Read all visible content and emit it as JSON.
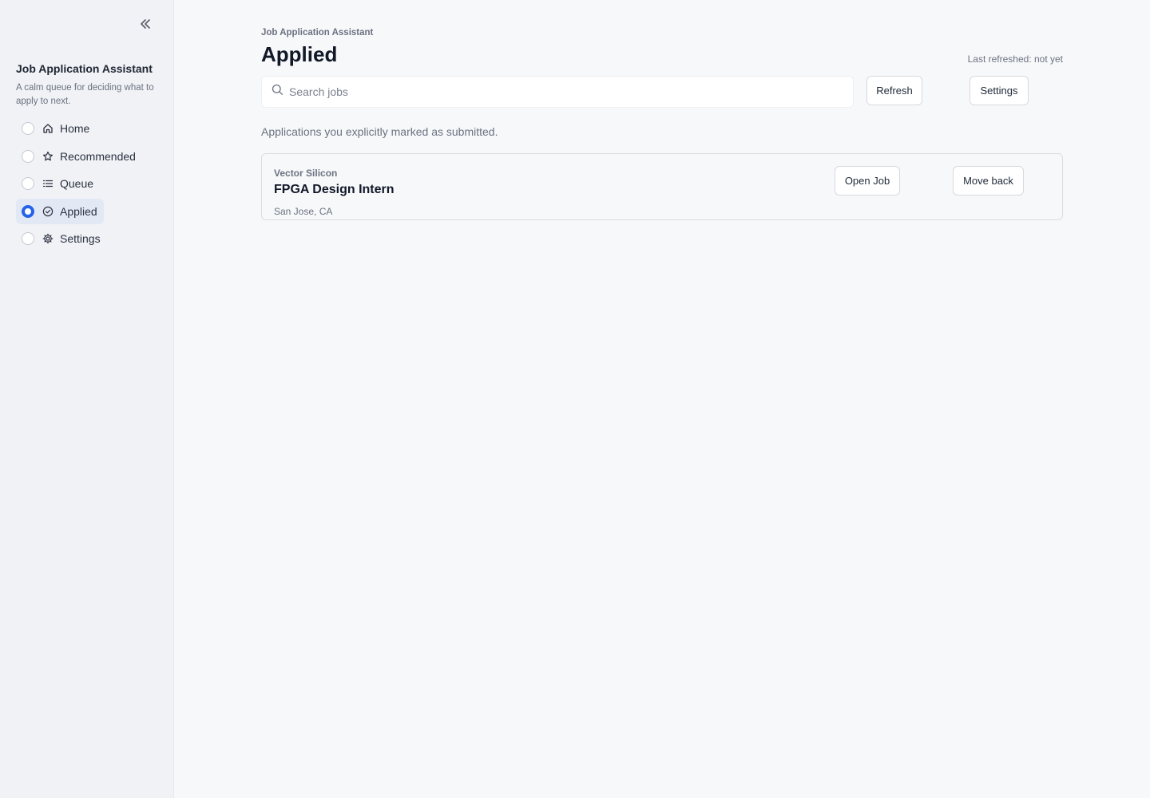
{
  "sidebar": {
    "title": "Job Application Assistant",
    "subtitle": "A calm queue for deciding what to apply to next.",
    "items": [
      {
        "label": "Home",
        "icon": "home-icon",
        "active": false
      },
      {
        "label": "Recommended",
        "icon": "star-icon",
        "active": false
      },
      {
        "label": "Queue",
        "icon": "list-icon",
        "active": false
      },
      {
        "label": "Applied",
        "icon": "check-circle-icon",
        "active": true
      },
      {
        "label": "Settings",
        "icon": "gear-icon",
        "active": false
      }
    ]
  },
  "header": {
    "eyebrow": "Job Application Assistant",
    "title": "Applied",
    "last_refreshed": "Last refreshed: not yet"
  },
  "toolbar": {
    "search_placeholder": "Search jobs",
    "refresh_label": "Refresh",
    "settings_label": "Settings"
  },
  "main": {
    "description": "Applications you explicitly marked as submitted.",
    "jobs": [
      {
        "company": "Vector Silicon",
        "title": "FPGA Design Intern",
        "location": "San Jose, CA",
        "open_label": "Open Job",
        "move_back_label": "Move back"
      }
    ]
  },
  "colors": {
    "accent": "#2563eb",
    "sidebar_bg": "#f0f2f6",
    "page_bg": "#f7f8fa"
  }
}
